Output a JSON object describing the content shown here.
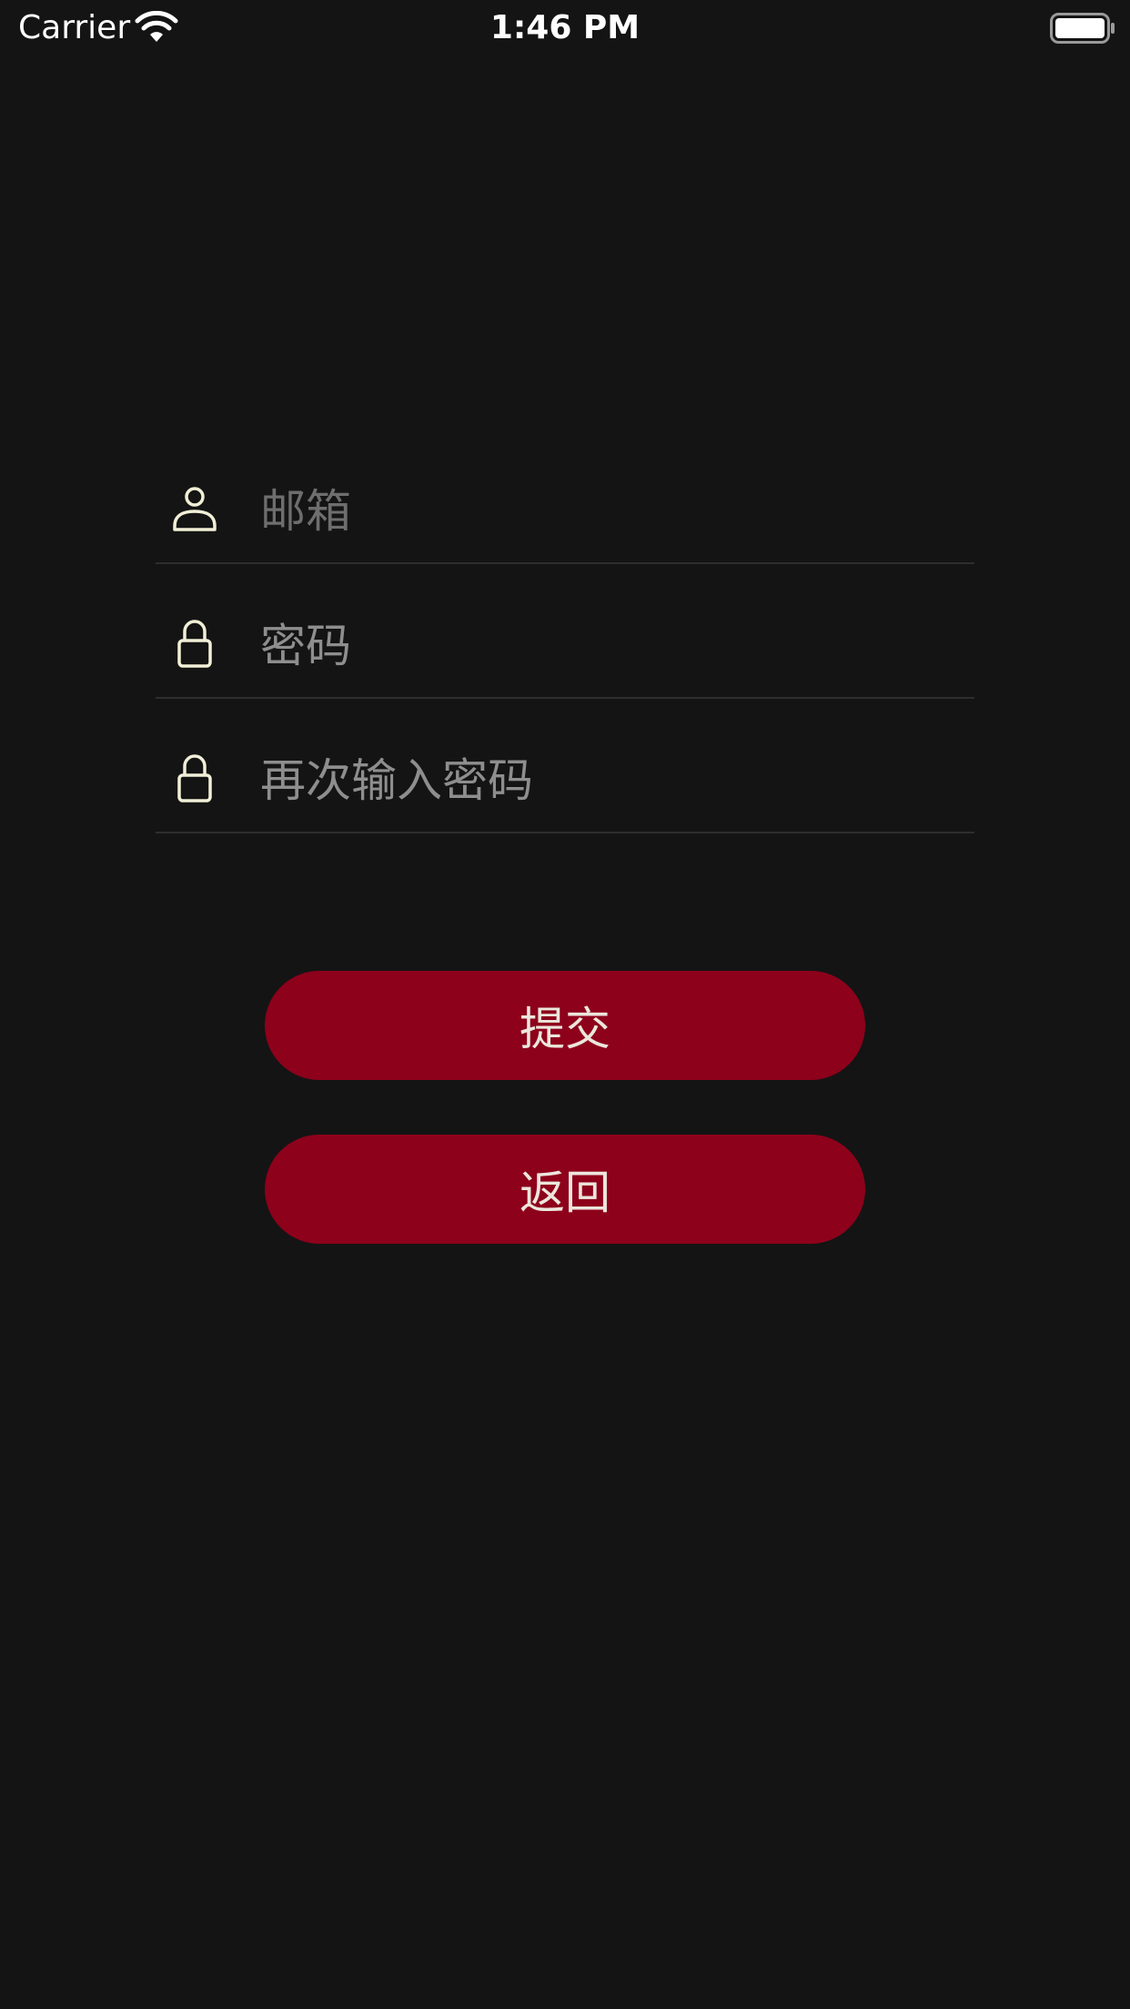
{
  "status_bar": {
    "carrier": "Carrier",
    "time": "1:46 PM",
    "icons": [
      "wifi-icon",
      "battery-icon"
    ]
  },
  "form": {
    "email": {
      "placeholder": "邮箱",
      "value": "",
      "icon": "person-icon"
    },
    "password": {
      "placeholder": "密码",
      "value": "",
      "icon": "lock-icon"
    },
    "confirm_password": {
      "placeholder": "再次输入密码",
      "value": "",
      "icon": "lock-icon"
    }
  },
  "buttons": {
    "submit_label": "提交",
    "back_label": "返回"
  },
  "colors": {
    "background": "#141414",
    "button": "#8d011b",
    "button_text": "#ece6dc",
    "icon_stroke": "#f1efd6",
    "divider": "#2e2e2e"
  }
}
